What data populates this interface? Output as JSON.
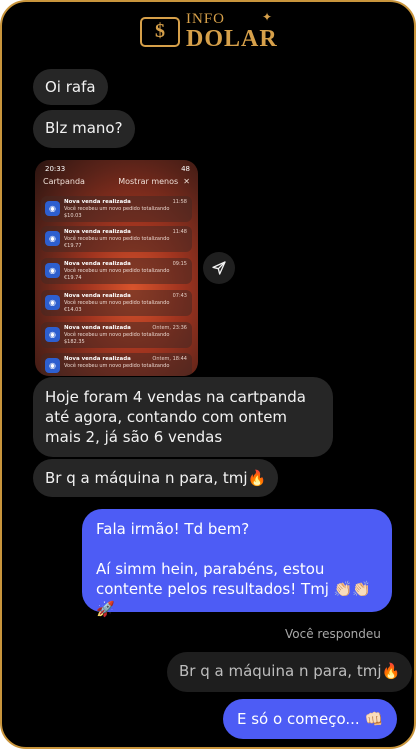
{
  "brand": {
    "line1": "INFO",
    "line2": "DOLAR",
    "badge": "$"
  },
  "messages_in": {
    "m1": "Oi rafa",
    "m2": "Blz mano?",
    "m3": "Hoje foram 4 vendas na cartpanda até agora, contando com ontem mais 2, já são 6 vendas",
    "m4": "Br q a máquina n para, tmj🔥"
  },
  "screenshot": {
    "time": "20:33",
    "battery": "48",
    "app": "Cartpanda",
    "show_less": "Mostrar menos",
    "close": "✕",
    "notifications": [
      {
        "title": "Nova venda realizada",
        "body": "Você recebeu um novo pedido totalizando",
        "amount": "$10.03",
        "time": "11:58"
      },
      {
        "title": "Nova venda realizada",
        "body": "Você recebeu um novo pedido totalizando",
        "amount": "€19.77",
        "time": "11:48"
      },
      {
        "title": "Nova venda realizada",
        "body": "Você recebeu um novo pedido totalizando",
        "amount": "€19.74",
        "time": "09:15"
      },
      {
        "title": "Nova venda realizada",
        "body": "Você recebeu um novo pedido totalizando",
        "amount": "€14.03",
        "time": "07:43"
      },
      {
        "title": "Nova venda realizada",
        "body": "Você recebeu um novo pedido totalizando",
        "amount": "$182.35",
        "time": "Ontem, 23:36"
      },
      {
        "title": "Nova venda realizada",
        "body": "Você recebeu um novo pedido totalizando",
        "amount": "",
        "time": "Ontem, 18:44"
      }
    ]
  },
  "messages_out": {
    "m1_line1": "Fala irmão! Td bem?",
    "m1_line2": "Aí simm hein, parabéns, estou contente pelos resultados! Tmj 👏🏻👏🏻🚀",
    "replied_label": "Você respondeu",
    "quoted": "Br q a máquina n para, tmj🔥",
    "m2": "E só o começo... 👊🏻"
  },
  "colors": {
    "accent_gold": "#d6a04a",
    "outgoing_bubble": "#4d5cf5",
    "incoming_bubble": "#262626",
    "background": "#000000"
  }
}
